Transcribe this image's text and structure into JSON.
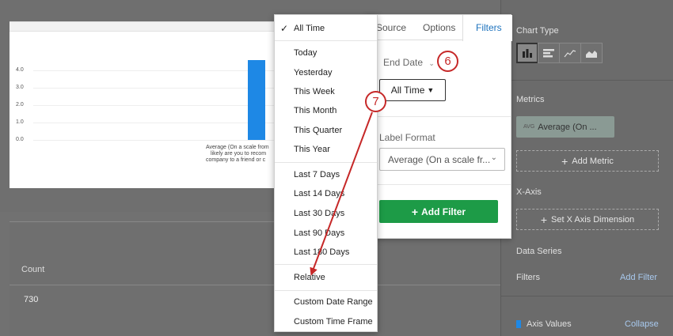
{
  "chart": {
    "y_ticks": [
      "4.0",
      "3.0",
      "2.0",
      "1.0",
      "0.0"
    ],
    "bar_label": [
      "Average (On a scale from",
      "likely are you to recom",
      "company to a friend or c"
    ],
    "bar_color": "#1e88e5"
  },
  "table": {
    "column_header": "Count",
    "value": "730"
  },
  "dropdown": {
    "selected": "All Time",
    "items": [
      "All Time",
      "Today",
      "Yesterday",
      "This Week",
      "This Month",
      "This Quarter",
      "This Year",
      "Last 7 Days",
      "Last 14 Days",
      "Last 30 Days",
      "Last 90 Days",
      "Last 180 Days",
      "Relative",
      "Custom Date Range",
      "Custom Time Frame"
    ]
  },
  "filter_panel": {
    "tabs": [
      "Source",
      "Options",
      "Filters"
    ],
    "active_tab": "Filters",
    "end_date_label": "End Date",
    "time_button": "All Time",
    "label_format_label": "Label Format",
    "label_format_value": "Average (On a scale fr...",
    "add_filter_button": "Add Filter",
    "add_filter_color": "#1d9b47"
  },
  "right_panel": {
    "chart_type_label": "Chart Type",
    "chart_types": [
      "bar-chart-icon",
      "horizontal-bar-icon",
      "line-chart-icon",
      "area-chart-icon"
    ],
    "metrics_label": "Metrics",
    "metric_prefix": "AVG",
    "metric_value": "Average (On ...",
    "add_metric": "Add Metric",
    "x_axis_label": "X-Axis",
    "x_axis_button": "Set X Axis Dimension",
    "data_series_label": "Data Series",
    "filters_label": "Filters",
    "filters_link": "Add Filter",
    "axis_values_label": "Axis Values",
    "collapse_link": "Collapse"
  },
  "callouts": {
    "six": "6",
    "seven": "7",
    "color": "#c62828"
  }
}
